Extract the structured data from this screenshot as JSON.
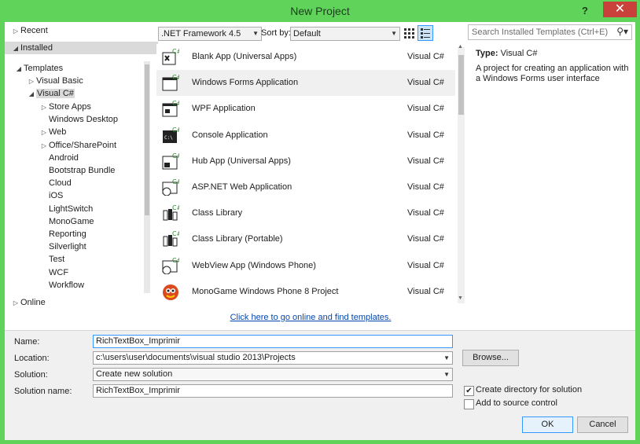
{
  "window": {
    "title": "New Project",
    "help_icon": "question-mark-icon",
    "close_icon": "close-icon",
    "accent": "#5fd35a"
  },
  "tree": {
    "recent": "Recent",
    "installed": "Installed",
    "templates": "Templates",
    "visual_basic": "Visual Basic",
    "visual_csharp": "Visual C#",
    "children": [
      "Store Apps",
      "Windows Desktop",
      "Web",
      "Office/SharePoint",
      "Android",
      "Bootstrap Bundle",
      "Cloud",
      "iOS",
      "LightSwitch",
      "MonoGame",
      "Reporting",
      "Silverlight",
      "Test",
      "WCF",
      "Workflow"
    ],
    "online": "Online"
  },
  "toolbar": {
    "framework": ".NET Framework 4.5",
    "sort_by_label": "Sort by:",
    "sort_by_value": "Default",
    "search_placeholder": "Search Installed Templates (Ctrl+E)"
  },
  "templates": [
    {
      "name": "Blank App (Universal Apps)",
      "lang": "Visual C#"
    },
    {
      "name": "Windows Forms Application",
      "lang": "Visual C#"
    },
    {
      "name": "WPF Application",
      "lang": "Visual C#"
    },
    {
      "name": "Console Application",
      "lang": "Visual C#"
    },
    {
      "name": "Hub App (Universal Apps)",
      "lang": "Visual C#"
    },
    {
      "name": "ASP.NET Web Application",
      "lang": "Visual C#"
    },
    {
      "name": "Class Library",
      "lang": "Visual C#"
    },
    {
      "name": "Class Library (Portable)",
      "lang": "Visual C#"
    },
    {
      "name": "WebView App (Windows Phone)",
      "lang": "Visual C#"
    },
    {
      "name": "MonoGame Windows Phone 8 Project",
      "lang": "Visual C#"
    }
  ],
  "online_link": "Click here to go online and find templates.",
  "details": {
    "type_label": "Type:",
    "type_value": "Visual C#",
    "description": "A project for creating an application with a Windows Forms user interface"
  },
  "form": {
    "name_label": "Name:",
    "name_value": "RichTextBox_Imprimir",
    "location_label": "Location:",
    "location_value": "c:\\users\\user\\documents\\visual studio 2013\\Projects",
    "browse": "Browse...",
    "solution_label": "Solution:",
    "solution_value": "Create new solution",
    "solution_name_label": "Solution name:",
    "solution_name_value": "RichTextBox_Imprimir",
    "create_dir": "Create directory for solution",
    "create_dir_checked": true,
    "source_control": "Add to source control",
    "source_control_checked": false,
    "ok": "OK",
    "cancel": "Cancel"
  }
}
